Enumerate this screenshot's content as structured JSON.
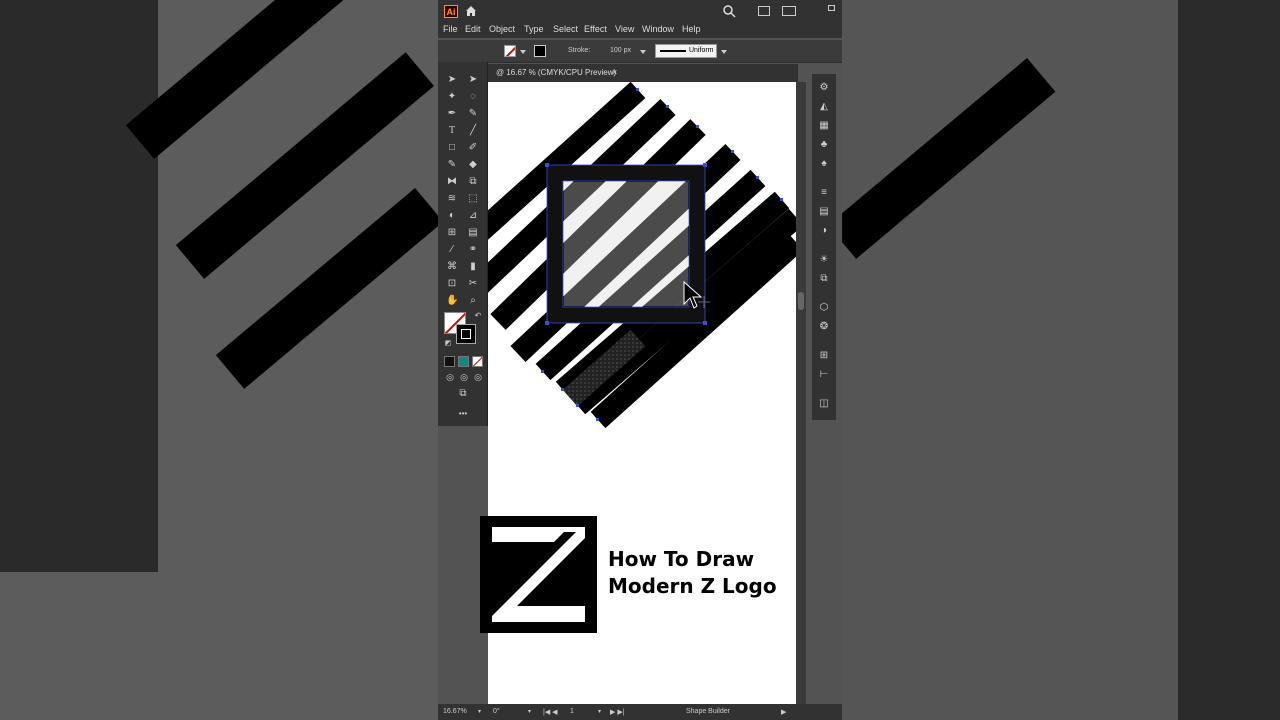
{
  "app": {
    "logo_text": "Ai",
    "menu": [
      "File",
      "Edit",
      "Object",
      "Type",
      "Select",
      "Effect",
      "View",
      "Window",
      "Help"
    ],
    "control_bar": {
      "stroke_label": "Stroke:",
      "stroke_value": "100 px",
      "profile": "Uniform"
    },
    "document_tab": {
      "label": "@ 16.67 % (CMYK/CPU Preview)",
      "close": "×"
    },
    "toolbar_more": "•••",
    "status_bar": {
      "zoom": "16.67%",
      "rotation": "0°",
      "artboard": "1",
      "tool": "Shape Builder"
    },
    "colors": {
      "selection": "#3a4fd6",
      "ui_dark": "#323232",
      "ui_mid": "#535353",
      "accent_red": "#d00000"
    }
  },
  "overlay": {
    "title_line1": "How To Draw",
    "title_line2": "Modern Z Logo"
  }
}
